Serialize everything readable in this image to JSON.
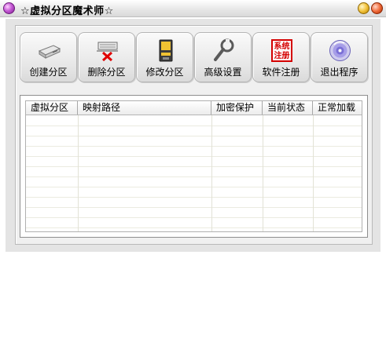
{
  "window": {
    "title": "☆虚拟分区魔术师☆"
  },
  "toolbar": {
    "items": [
      {
        "label": "创建分区",
        "icon": "drive-icon"
      },
      {
        "label": "删除分区",
        "icon": "delete-drive-icon"
      },
      {
        "label": "修改分区",
        "icon": "floppy-edit-icon"
      },
      {
        "label": "高级设置",
        "icon": "wrench-icon"
      },
      {
        "label": "软件注册",
        "icon": "register-stamp-icon",
        "stamp_text_top": "系统",
        "stamp_text_bottom": "注册"
      },
      {
        "label": "退出程序",
        "icon": "cd-exit-icon"
      }
    ]
  },
  "partition_list": {
    "columns": [
      "虚拟分区",
      "映射路径",
      "加密保护",
      "当前状态",
      "正常加载"
    ],
    "rows": []
  },
  "colors": {
    "stamp_red": "#d40000",
    "delete_x": "#e00000",
    "floppy_yellow": "#f1c232",
    "floppy_dark": "#3c3c3c",
    "cd_purple": "#7a6fd6"
  }
}
